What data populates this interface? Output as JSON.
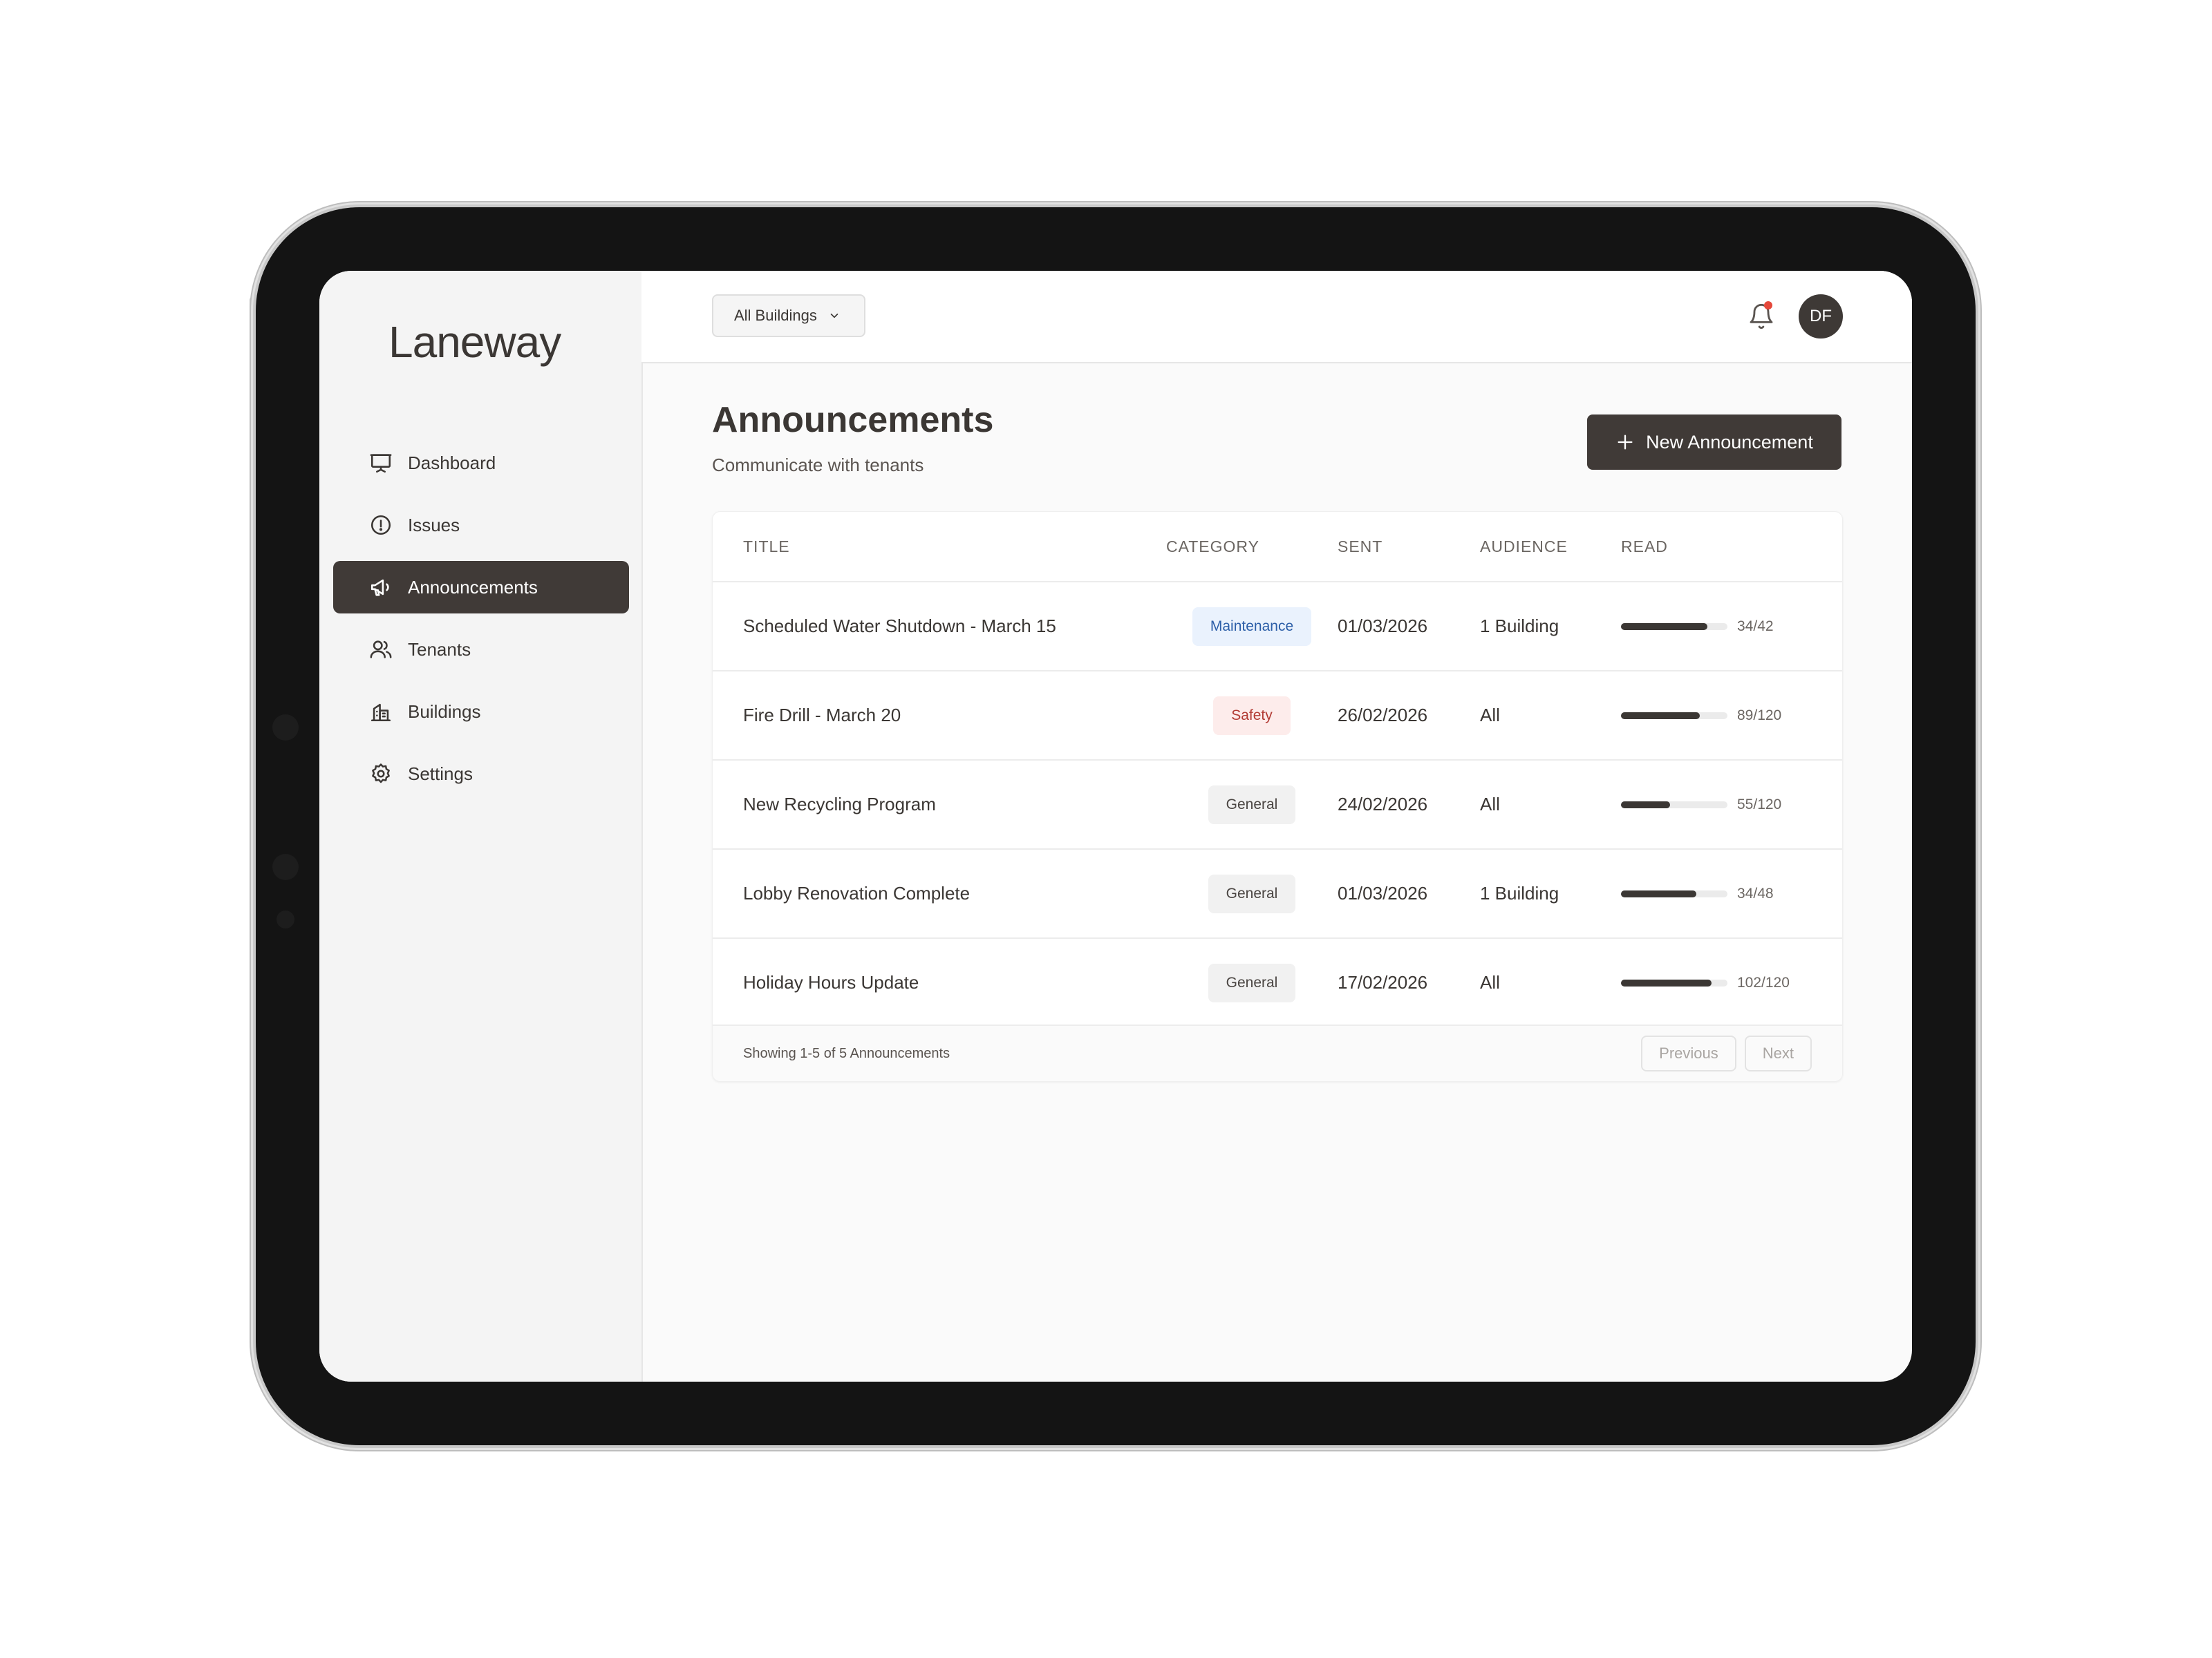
{
  "app": {
    "logo": "Laneway"
  },
  "sidebar": {
    "items": [
      {
        "label": "Dashboard",
        "icon": "presentation-icon",
        "active": false
      },
      {
        "label": "Issues",
        "icon": "alert-circle-icon",
        "active": false
      },
      {
        "label": "Announcements",
        "icon": "megaphone-icon",
        "active": true
      },
      {
        "label": "Tenants",
        "icon": "users-icon",
        "active": false
      },
      {
        "label": "Buildings",
        "icon": "building-icon",
        "active": false
      },
      {
        "label": "Settings",
        "icon": "gear-icon",
        "active": false
      }
    ]
  },
  "topbar": {
    "building_filter": "All Buildings",
    "avatar_initials": "DF",
    "notification_dot_color": "#e5483b"
  },
  "page": {
    "title": "Announcements",
    "subtitle": "Communicate with tenants",
    "new_button_label": "New Announcement"
  },
  "table": {
    "headers": {
      "title": "TITLE",
      "category": "CATEGORY",
      "sent": "SENT",
      "audience": "AUDIENCE",
      "read": "READ"
    },
    "rows": [
      {
        "title": "Scheduled Water Shutdown - March 15",
        "category": "Maintenance",
        "sent": "01/03/2026",
        "audience": "1 Building",
        "read": "34/42",
        "read_fraction": 0.81
      },
      {
        "title": "Fire Drill - March 20",
        "category": "Safety",
        "sent": "26/02/2026",
        "audience": "All",
        "read": "89/120",
        "read_fraction": 0.74
      },
      {
        "title": "New Recycling Program",
        "category": "General",
        "sent": "24/02/2026",
        "audience": "All",
        "read": "55/120",
        "read_fraction": 0.46
      },
      {
        "title": "Lobby Renovation Complete",
        "category": "General",
        "sent": "01/03/2026",
        "audience": "1 Building",
        "read": "34/48",
        "read_fraction": 0.71
      },
      {
        "title": "Holiday Hours Update",
        "category": "General",
        "sent": "17/02/2026",
        "audience": "All",
        "read": "102/120",
        "read_fraction": 0.85
      }
    ],
    "footer": {
      "showing_text": "Showing 1-5 of 5 Announcements",
      "previous_label": "Previous",
      "next_label": "Next"
    }
  },
  "colors": {
    "accent_dark": "#403a37",
    "maintenance_badge_bg": "#eaf2fd",
    "maintenance_badge_text": "#2d5fa8",
    "safety_badge_bg": "#fdeceb",
    "safety_badge_text": "#b23b34",
    "general_badge_bg": "#f1f1f1"
  }
}
